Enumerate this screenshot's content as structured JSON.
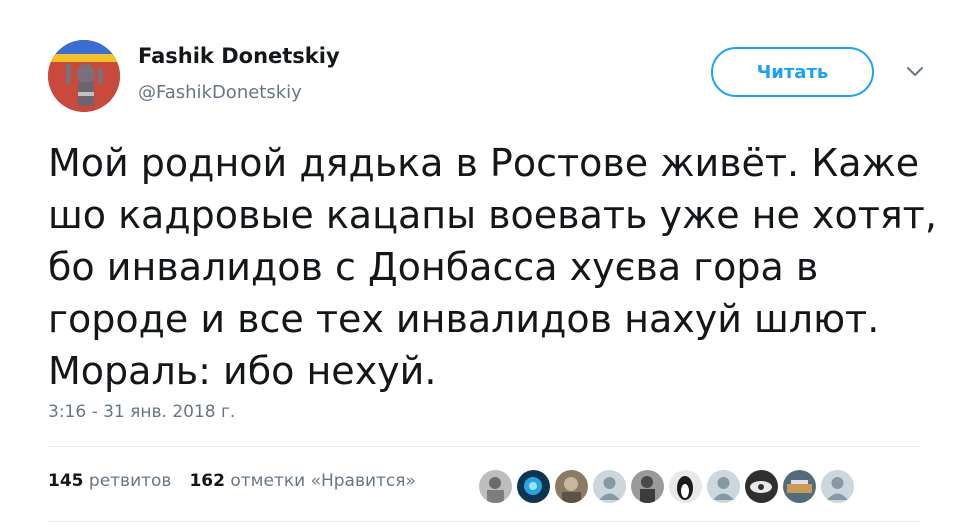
{
  "author": {
    "name": "Fashik Donetskiy",
    "handle": "@FashikDonetskiy"
  },
  "follow_button": {
    "label": "Читать"
  },
  "tweet": {
    "lines": [
      "Мой родной дядька в Ростове живёт. Каже",
      "шо кадровые кацапы воевать уже не хотят,",
      "бо инвалидов с Донбасса хуєва гора в",
      "городе и все тех инвалидов нахуй шлют.",
      "Мораль: ибо нехуй."
    ]
  },
  "timestamp": "3:16 - 31 янв. 2018 г.",
  "stats": {
    "retweets_count": "145",
    "retweets_label": "ретвитов",
    "likes_count": "162",
    "likes_label": "отметки «Нравится»"
  },
  "colors": {
    "accent": "#1da1f2",
    "text": "#14171a",
    "secondary": "#657786",
    "divider": "#e6ecf0"
  },
  "icons": {
    "menu_caret": "chevron-down-icon",
    "default_avatar": "default-avatar-icon"
  }
}
